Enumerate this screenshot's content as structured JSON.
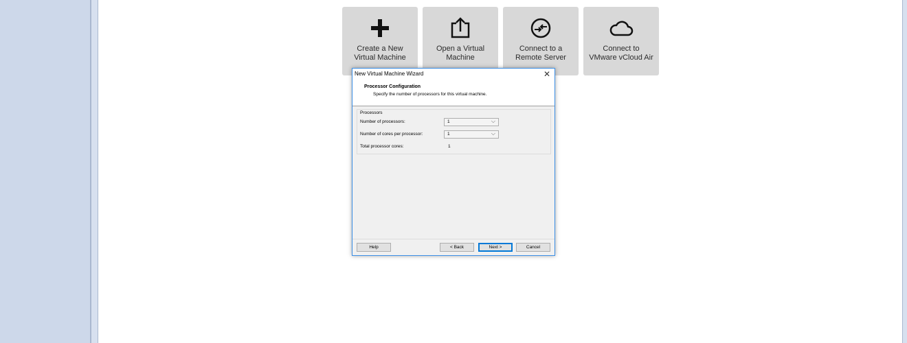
{
  "tiles": [
    {
      "label": "Create a New\nVirtual Machine",
      "icon": "plus-icon"
    },
    {
      "label": "Open a Virtual\nMachine",
      "icon": "open-export-icon"
    },
    {
      "label": "Connect to a\nRemote Server",
      "icon": "remote-connect-icon"
    },
    {
      "label": "Connect to\nVMware vCloud Air",
      "icon": "cloud-icon"
    }
  ],
  "dialog": {
    "title": "New Virtual Machine Wizard",
    "close": "✕",
    "heading": "Processor Configuration",
    "subheading": "Specify the number of processors for this virtual machine.",
    "group_title": "Processors",
    "fields": {
      "num_processors_label": "Number of processors:",
      "num_processors_value": "1",
      "cores_label": "Number of cores per processor:",
      "cores_value": "1",
      "total_label": "Total processor cores:",
      "total_value": "1"
    },
    "buttons": {
      "help": "Help",
      "back": "< Back",
      "next": "Next >",
      "cancel": "Cancel"
    }
  }
}
